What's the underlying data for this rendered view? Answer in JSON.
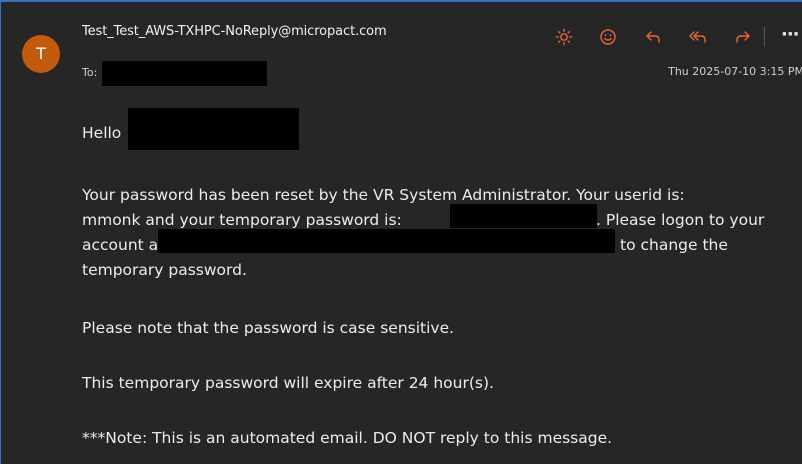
{
  "email": {
    "avatar_initial": "T",
    "sender": "Test_Test_AWS-TXHPC-NoReply@micropact.com",
    "to_label": "To:",
    "date": "Thu 2025-07-10 3:15 PM"
  },
  "toolbar": {
    "icons": [
      "brightness-icon",
      "emoji-icon",
      "reply-icon",
      "reply-all-icon",
      "forward-icon",
      "more-icon"
    ],
    "more_label": "···",
    "accent_color": "#e8653a"
  },
  "message": {
    "greeting": "Hello",
    "line1": "Your password has been reset by the VR System Administrator. Your userid is:",
    "line2a": "mmonk and your temporary password is:",
    "line2b": ". Please logon to your",
    "line3a": "account at",
    "line3b": "to change the",
    "line4": "temporary password.",
    "note_case": "Please note that the password is case sensitive.",
    "note_expire": "This temporary password will expire after 24 hour(s).",
    "note_auto": "***Note: This is an automated email. DO NOT reply to this message."
  }
}
